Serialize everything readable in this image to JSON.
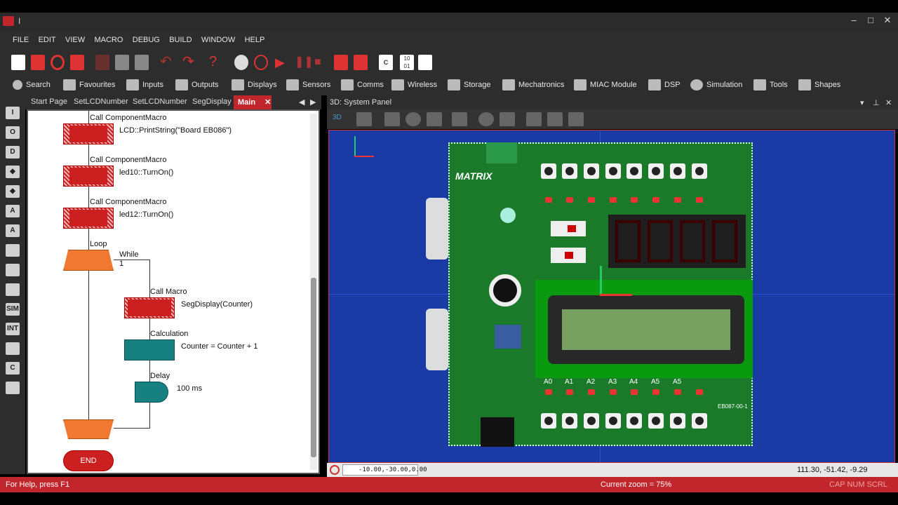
{
  "window": {
    "title": "I"
  },
  "menu": [
    "FILE",
    "EDIT",
    "VIEW",
    "MACRO",
    "DEBUG",
    "BUILD",
    "WINDOW",
    "HELP"
  ],
  "component_toolbar": [
    {
      "label": "Search",
      "icon": "search-icon"
    },
    {
      "label": "Favourites",
      "icon": "star-icon"
    },
    {
      "label": "Inputs",
      "icon": "inputs-icon"
    },
    {
      "label": "Outputs",
      "icon": "outputs-icon"
    },
    {
      "label": "Displays",
      "icon": "display-icon"
    },
    {
      "label": "Sensors",
      "icon": "sensor-icon"
    },
    {
      "label": "Comms",
      "icon": "comms-icon"
    },
    {
      "label": "Wireless",
      "icon": "wifi-icon"
    },
    {
      "label": "Storage",
      "icon": "storage-icon"
    },
    {
      "label": "Mechatronics",
      "icon": "mechatronics-icon"
    },
    {
      "label": "MIAC Module",
      "icon": "miac-icon"
    },
    {
      "label": "DSP",
      "icon": "dsp-icon"
    },
    {
      "label": "Simulation",
      "icon": "gear-icon"
    },
    {
      "label": "Tools",
      "icon": "tools-icon"
    },
    {
      "label": "Shapes",
      "icon": "shapes-icon"
    }
  ],
  "tabs": [
    "Start Page",
    "SetLCDNumber",
    "SetLCDNumber",
    "SegDisplay",
    "Main"
  ],
  "left_tools": [
    "I",
    "O",
    "D",
    "◆",
    "◆",
    "A",
    "A",
    "",
    "",
    "",
    "SIM",
    "INT",
    "",
    "C",
    ""
  ],
  "flowchart": {
    "block1": {
      "title": "Call ComponentMacro",
      "text": "LCD::PrintString(\"Board EB086\")"
    },
    "block2": {
      "title": "Call ComponentMacro",
      "text": "led10::TurnOn()"
    },
    "block3": {
      "title": "Call ComponentMacro",
      "text": "led12::TurnOn()"
    },
    "loop": {
      "title": "Loop",
      "cond": "While",
      "val": "1"
    },
    "call": {
      "title": "Call Macro",
      "text": "SegDisplay(Counter)"
    },
    "calc": {
      "title": "Calculation",
      "text": "Counter = Counter + 1"
    },
    "delay": {
      "title": "Delay",
      "text": "100 ms"
    },
    "end": "END"
  },
  "panel": {
    "title": "3D: System Panel",
    "board_brand": "MATRIX",
    "analog_labels": [
      "A0",
      "A1",
      "A2",
      "A3",
      "A4",
      "A5",
      "A5"
    ],
    "board_code": "EB087-00-1",
    "coords_left": "-10.00,-30.00,0.00",
    "coords_right": "111.30, -51.42, -9.29"
  },
  "status": {
    "help": "For Help, press F1",
    "zoom": "Current zoom = 75%",
    "keys": "CAP  NUM  SCRL"
  },
  "colors": {
    "accent": "#c0262b",
    "board": "#1a7a2a",
    "view_bg": "#1a3aa5"
  }
}
